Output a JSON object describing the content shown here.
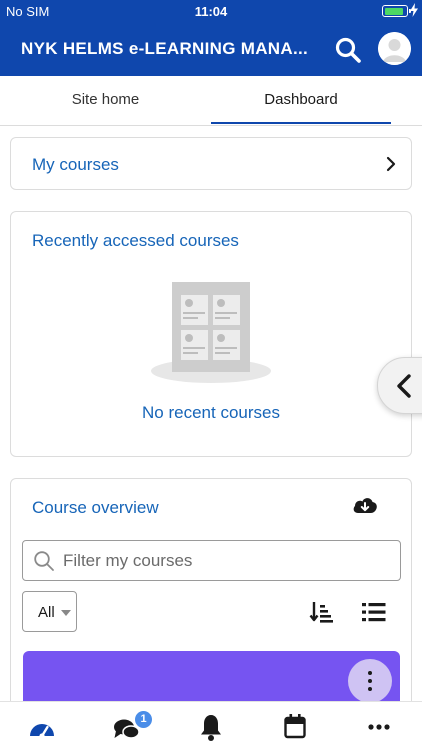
{
  "status": {
    "carrier": "No SIM",
    "time": "11:04",
    "battery_level": 0.9
  },
  "header": {
    "title": "NYK HELMS e-LEARNING MANA..."
  },
  "tabs": [
    {
      "label": "Site home"
    },
    {
      "label": "Dashboard"
    }
  ],
  "my_courses": {
    "label": "My courses"
  },
  "recent": {
    "title": "Recently accessed courses",
    "empty_text": "No recent courses"
  },
  "overview": {
    "title": "Course overview",
    "search_placeholder": "Filter my courses",
    "filter_value": "All",
    "course_tile_color": "#7654f1"
  },
  "bottom_nav": {
    "messages_badge": "1"
  },
  "colors": {
    "brand": "#0f47ad",
    "link": "#1765b8"
  }
}
